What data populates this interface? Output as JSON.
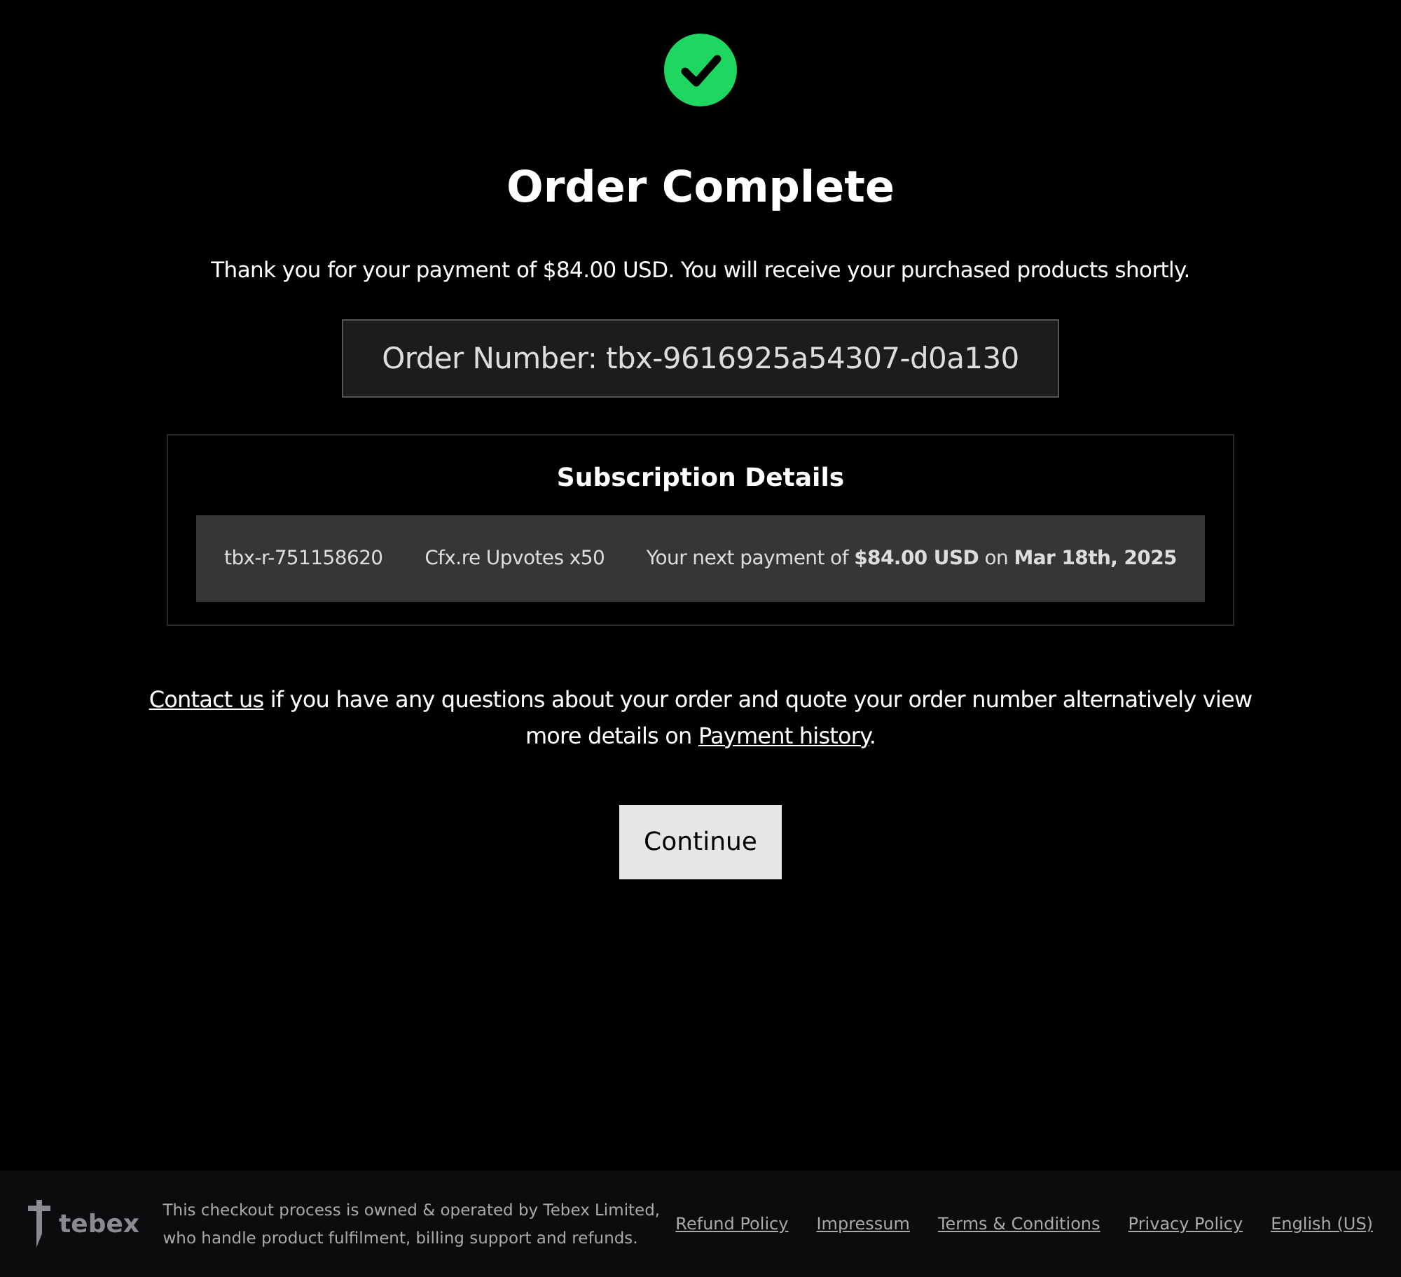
{
  "status": {
    "title": "Order Complete",
    "message": "Thank you for your payment of $84.00 USD. You will receive your purchased products shortly.",
    "order_number": "Order Number: tbx-9616925a54307-d0a130"
  },
  "subscription": {
    "title": "Subscription Details",
    "row": {
      "id": "tbx-r-751158620",
      "product": "Cfx.re Upvotes x50",
      "next_payment": "Your next payment of **$84.00 USD** on **Mar 18th, 2025**"
    }
  },
  "help_text": [
    {
      "kind": "link",
      "text": "Contact us"
    },
    {
      "kind": "text",
      "text": " if you have any questions about your order and quote your order number alternatively view more details on "
    },
    {
      "kind": "link",
      "text": "Payment history"
    },
    {
      "kind": "text",
      "text": "."
    }
  ],
  "continue_button": "Continue",
  "footer": {
    "logo": "tebex",
    "notice": "This checkout process is owned & operated by Tebex Limited, who handle product fulfilment, billing support and refunds.",
    "links": [
      "Refund Policy",
      "Impressum",
      "Terms & Conditions",
      "Privacy Policy",
      "English (US)"
    ]
  }
}
